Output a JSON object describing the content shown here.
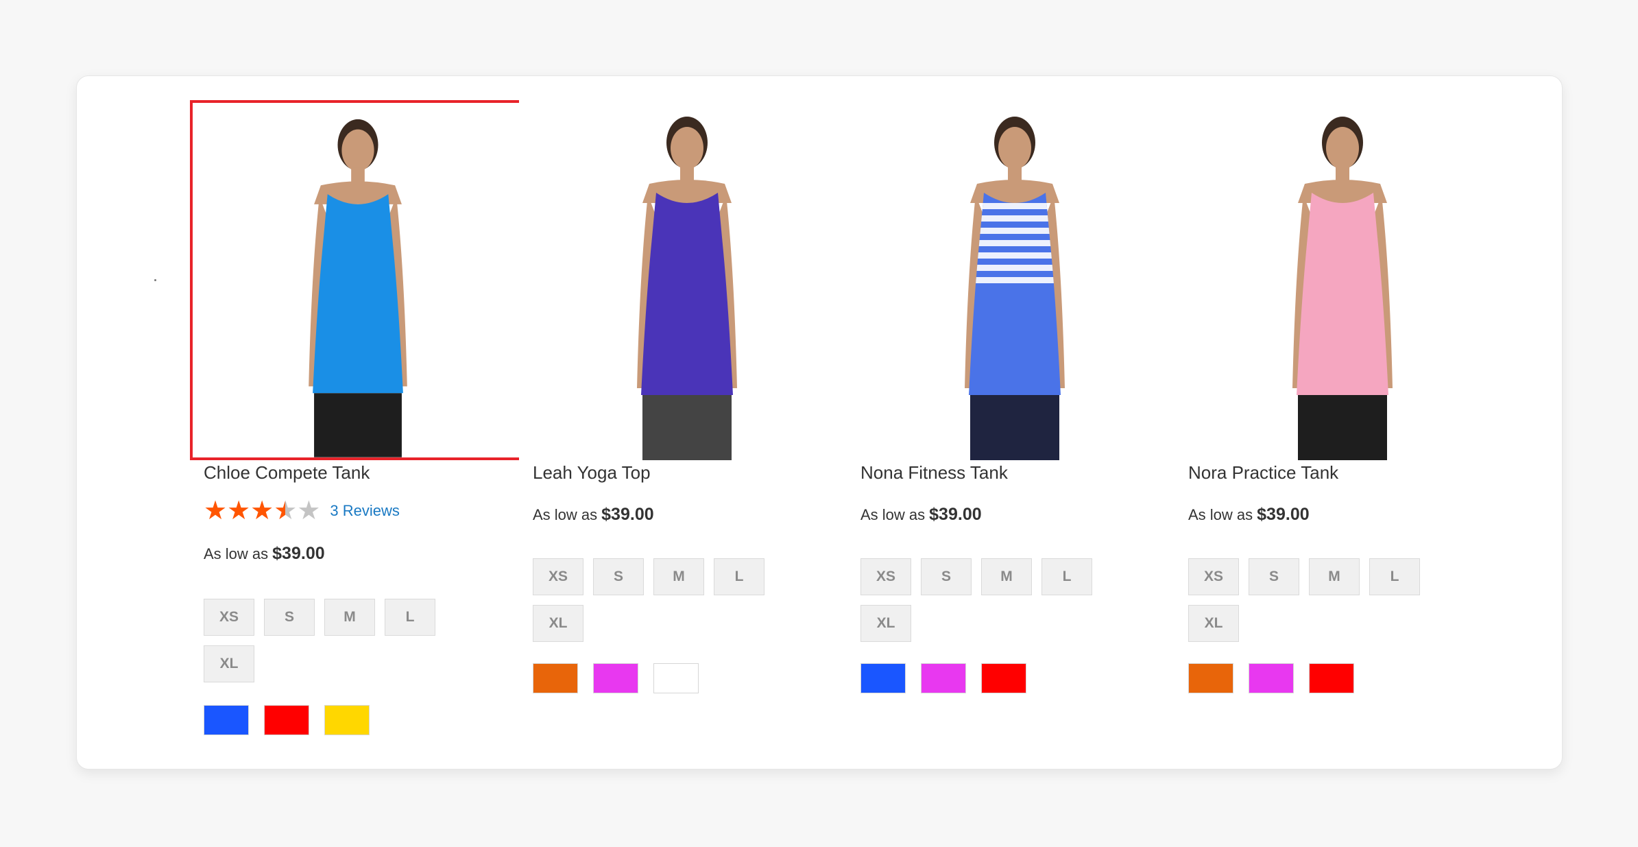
{
  "products": [
    {
      "name": "Chloe Compete Tank",
      "rating": {
        "stars": 3.5,
        "max": 5,
        "reviews_label": "3 Reviews"
      },
      "price_prefix": "As low as",
      "price": "$39.00",
      "sizes": [
        "XS",
        "S",
        "M",
        "L",
        "XL"
      ],
      "colors": [
        "#1a56ff",
        "#ff0000",
        "#ffd700"
      ],
      "highlighted": true,
      "top_color": "#1a8fe6",
      "bottom_color": "#1e1e1e"
    },
    {
      "name": "Leah Yoga Top",
      "price_prefix": "As low as",
      "price": "$39.00",
      "sizes": [
        "XS",
        "S",
        "M",
        "L",
        "XL"
      ],
      "colors": [
        "#e8650a",
        "#e838f0",
        "#ffffff"
      ],
      "highlighted": false,
      "top_color": "#4a34b8",
      "bottom_color": "#444444"
    },
    {
      "name": "Nona Fitness Tank",
      "price_prefix": "As low as",
      "price": "$39.00",
      "sizes": [
        "XS",
        "S",
        "M",
        "L",
        "XL"
      ],
      "colors": [
        "#1a56ff",
        "#e838f0",
        "#ff0000"
      ],
      "highlighted": false,
      "top_color": "#4a73e8",
      "bottom_color": "#1f2440"
    },
    {
      "name": "Nora Practice Tank",
      "price_prefix": "As low as",
      "price": "$39.00",
      "sizes": [
        "XS",
        "S",
        "M",
        "L",
        "XL"
      ],
      "colors": [
        "#e8650a",
        "#e838f0",
        "#ff0000"
      ],
      "highlighted": false,
      "top_color": "#f5a6c0",
      "bottom_color": "#1e1e1e"
    }
  ],
  "star_colors": {
    "filled": "#ff5501",
    "empty": "#c4c4c4"
  }
}
